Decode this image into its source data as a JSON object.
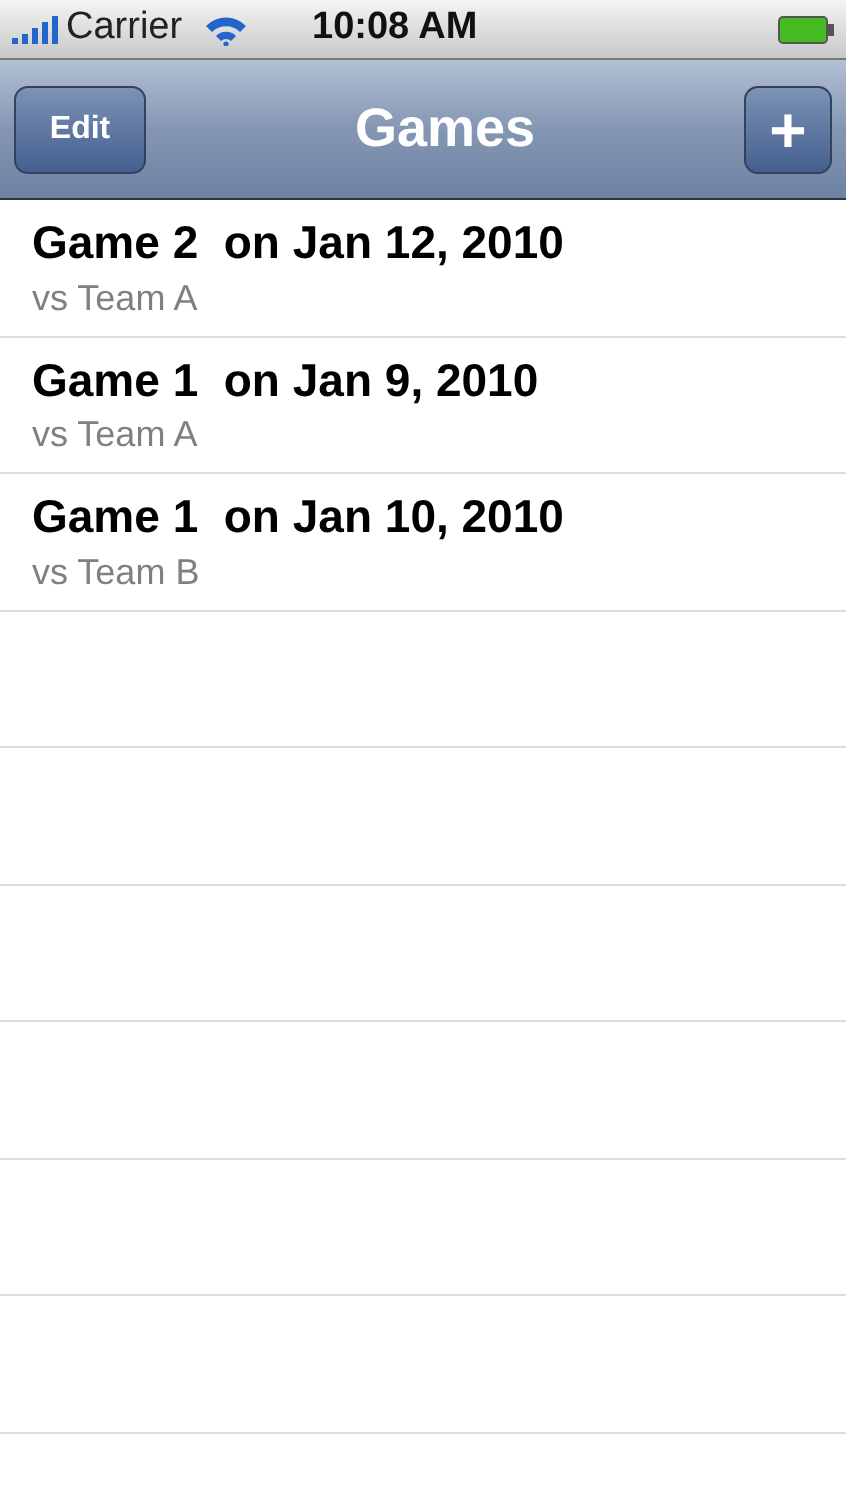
{
  "status_bar": {
    "carrier": "Carrier",
    "time": "10:08 AM"
  },
  "nav_bar": {
    "left_button": "Edit",
    "title": "Games",
    "right_button": "+"
  },
  "games": [
    {
      "title": "Game 2  on Jan 12, 2010",
      "subtitle": "vs Team A"
    },
    {
      "title": "Game 1  on Jan 9, 2010",
      "subtitle": "vs Team A"
    },
    {
      "title": "Game 1  on Jan 10, 2010",
      "subtitle": "vs Team B"
    }
  ]
}
